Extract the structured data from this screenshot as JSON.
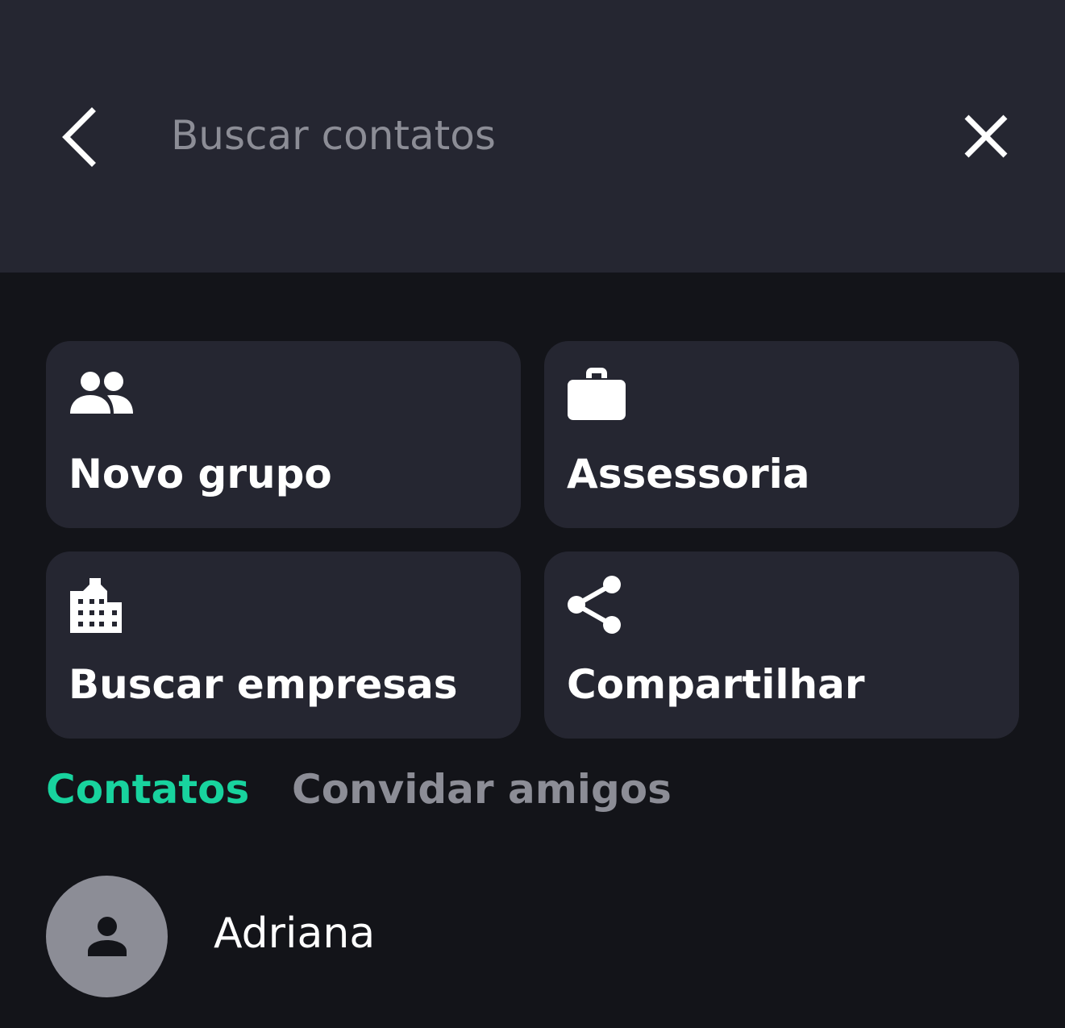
{
  "header": {
    "search_placeholder": "Buscar contatos",
    "back_icon": "chevron-left-icon",
    "close_icon": "close-icon"
  },
  "actions": [
    {
      "label": "Novo grupo",
      "icon": "group-icon"
    },
    {
      "label": "Assessoria",
      "icon": "briefcase-icon"
    },
    {
      "label": "Buscar empresas",
      "icon": "building-icon"
    },
    {
      "label": "Compartilhar",
      "icon": "share-icon"
    }
  ],
  "tabs": [
    {
      "label": "Contatos",
      "active": true
    },
    {
      "label": "Convidar amigos",
      "active": false
    }
  ],
  "contacts": [
    {
      "name": "Adriana",
      "icon": "person-icon"
    }
  ],
  "colors": {
    "header_bg": "#252631",
    "page_bg": "#131419",
    "card_bg": "#252631",
    "accent": "#18d39e",
    "muted": "#8c8d96",
    "text": "#ffffff"
  }
}
